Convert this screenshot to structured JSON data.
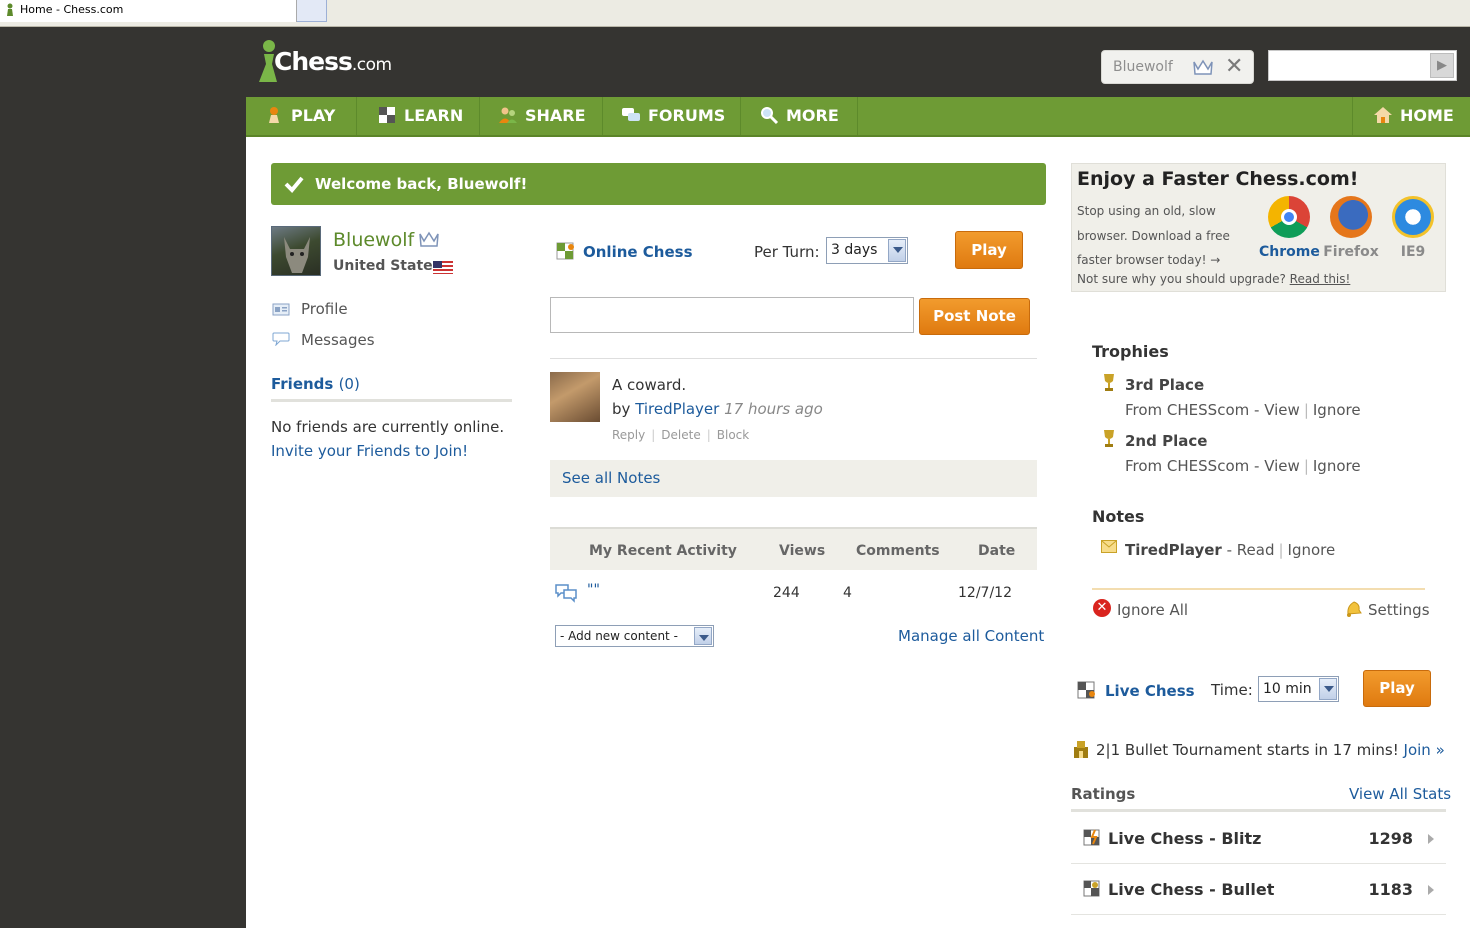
{
  "browser": {
    "tab_title": "Home - Chess.com"
  },
  "header": {
    "logo_main": "Chess",
    "logo_suffix": ".com",
    "user_chip": "Bluewolf",
    "search_placeholder": ""
  },
  "nav": [
    {
      "label": "PLAY",
      "icon": "pawn-icon"
    },
    {
      "label": "LEARN",
      "icon": "board-icon"
    },
    {
      "label": "SHARE",
      "icon": "people-icon"
    },
    {
      "label": "FORUMS",
      "icon": "speech-bubbles-icon"
    },
    {
      "label": "MORE",
      "icon": "magnifier-icon"
    }
  ],
  "nav_home": "HOME",
  "welcome": "Welcome back, Bluewolf!",
  "profile": {
    "username": "Bluewolf",
    "country": "United States",
    "links": [
      "Profile",
      "Messages"
    ],
    "friends_label": "Friends",
    "friends_count": "(0)",
    "no_friends": "No friends are currently online.",
    "invite": "Invite your Friends to Join!"
  },
  "online_chess": {
    "label": "Online Chess",
    "per_turn_label": "Per Turn:",
    "per_turn_value": "3 days",
    "play": "Play"
  },
  "notes": {
    "post_button": "Post Note",
    "input_value": "",
    "item": {
      "text": "A coward.",
      "by": "by",
      "author": "TiredPlayer",
      "time": "17 hours ago",
      "actions": [
        "Reply",
        "Delete",
        "Block"
      ]
    },
    "see_all": "See all Notes"
  },
  "activity": {
    "headers": [
      "My Recent Activity",
      "Views",
      "Comments",
      "Date"
    ],
    "row": {
      "title": "\"\"",
      "views": "244",
      "comments": "4",
      "date": "12/7/12"
    },
    "add_select": "- Add new content -",
    "manage": "Manage all Content"
  },
  "promo": {
    "title": "Enjoy a Faster Chess.com!",
    "body": "Stop using an old, slow browser. Download a free faster browser today! →",
    "foot_prefix": "Not sure why you should upgrade?",
    "foot_link": "Read this!",
    "browsers": [
      "Chrome",
      "Firefox",
      "IE9"
    ],
    "colors": {
      "chrome": "#1d5b9c",
      "other": "#8a8a8a"
    }
  },
  "trophies": {
    "heading": "Trophies",
    "items": [
      {
        "name": "3rd Place",
        "from": "From CHESScom",
        "view": "View",
        "ignore": "Ignore"
      },
      {
        "name": "2nd Place",
        "from": "From CHESScom",
        "view": "View",
        "ignore": "Ignore"
      }
    ]
  },
  "right_notes": {
    "heading": "Notes",
    "author": "TiredPlayer",
    "read": "Read",
    "ignore": "Ignore",
    "ignore_all": "Ignore All",
    "settings": "Settings"
  },
  "live_chess": {
    "label": "Live Chess",
    "time_label": "Time:",
    "time_value": "10 min",
    "play": "Play",
    "tournament": "2|1 Bullet Tournament starts in 17 mins!",
    "join": "Join »"
  },
  "ratings": {
    "heading": "Ratings",
    "view_all": "View All Stats",
    "rows": [
      {
        "name": "Live Chess - Blitz",
        "value": "1298"
      },
      {
        "name": "Live Chess - Bullet",
        "value": "1183"
      }
    ]
  },
  "colors": {
    "brand_green": "#6e9b35",
    "accent_orange": "#e8860f",
    "link_blue": "#1d5b9c",
    "page_dark": "#353431"
  }
}
